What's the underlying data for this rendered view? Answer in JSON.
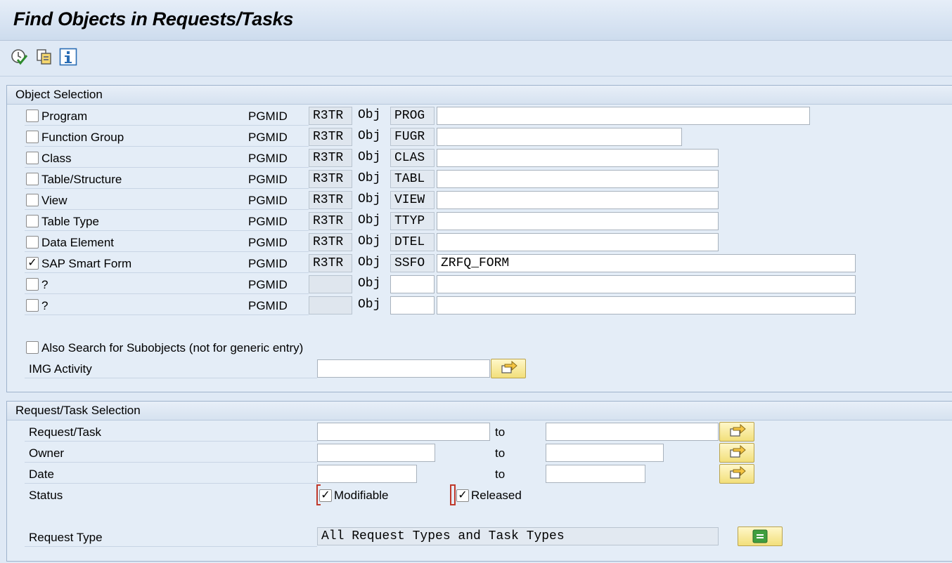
{
  "title": "Find Objects in Requests/Tasks",
  "toolbar": {
    "icons": [
      "execute-icon",
      "copy-variant-icon",
      "info-icon"
    ]
  },
  "object_selection": {
    "header": "Object Selection",
    "pgmid_label": "PGMID",
    "obj_label": "Obj",
    "rows": [
      {
        "label": "Program",
        "checked": false,
        "pgmid": "R3TR",
        "obj": "PROG",
        "value": ""
      },
      {
        "label": "Function Group",
        "checked": false,
        "pgmid": "R3TR",
        "obj": "FUGR",
        "value": ""
      },
      {
        "label": "Class",
        "checked": false,
        "pgmid": "R3TR",
        "obj": "CLAS",
        "value": ""
      },
      {
        "label": "Table/Structure",
        "checked": false,
        "pgmid": "R3TR",
        "obj": "TABL",
        "value": ""
      },
      {
        "label": "View",
        "checked": false,
        "pgmid": "R3TR",
        "obj": "VIEW",
        "value": ""
      },
      {
        "label": "Table Type",
        "checked": false,
        "pgmid": "R3TR",
        "obj": "TTYP",
        "value": ""
      },
      {
        "label": "Data Element",
        "checked": false,
        "pgmid": "R3TR",
        "obj": "DTEL",
        "value": ""
      },
      {
        "label": "SAP Smart Form",
        "checked": true,
        "pgmid": "R3TR",
        "obj": "SSFO",
        "value": "ZRFQ_FORM"
      },
      {
        "label": "?",
        "checked": false,
        "pgmid": "",
        "obj": "",
        "value": ""
      },
      {
        "label": "?",
        "checked": false,
        "pgmid": "",
        "obj": "",
        "value": ""
      }
    ],
    "subobjects_label": "Also Search for Subobjects (not for generic entry)",
    "img_activity_label": "IMG Activity",
    "img_activity_value": ""
  },
  "request_selection": {
    "header": "Request/Task Selection",
    "to_label": "to",
    "request_task_label": "Request/Task",
    "owner_label": "Owner",
    "date_label": "Date",
    "status_label": "Status",
    "modifiable_label": "Modifiable",
    "released_label": "Released",
    "request_type_label": "Request Type",
    "request_type_value": "All Request Types and Task Types"
  },
  "check_mark": "✓",
  "colors": {
    "accent_yellow": "#f2df7a",
    "panel": "#e4edf7",
    "green_button": "#3f9e3f"
  }
}
